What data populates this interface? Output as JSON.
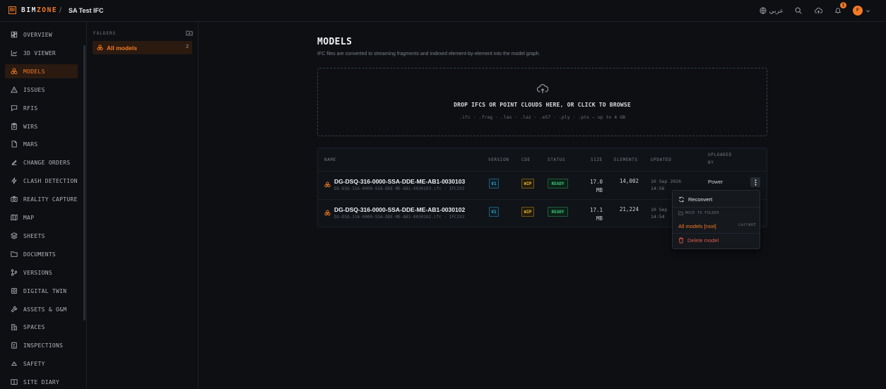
{
  "app": {
    "logo_mark": "BI",
    "logo_prefix": "BIM",
    "logo_suffix": "ZONE",
    "project": "SA Test IFC",
    "breadcrumb_separator": "/"
  },
  "topbar": {
    "language": "عربي",
    "notification_count": "1",
    "avatar_initial": "F"
  },
  "sidebar": {
    "items": [
      {
        "label": "OVERVIEW",
        "icon": "dashboard-icon"
      },
      {
        "label": "3D VIEWER",
        "icon": "chart-icon"
      },
      {
        "label": "MODELS",
        "icon": "models-icon",
        "active": true
      },
      {
        "label": "ISSUES",
        "icon": "warning-icon"
      },
      {
        "label": "RFIS",
        "icon": "chat-icon"
      },
      {
        "label": "WIRS",
        "icon": "clipboard-icon"
      },
      {
        "label": "MARS",
        "icon": "file-icon"
      },
      {
        "label": "CHANGE ORDERS",
        "icon": "edit-icon"
      },
      {
        "label": "CLASH DETECTION",
        "icon": "bolt-icon"
      },
      {
        "label": "REALITY CAPTURE",
        "icon": "camera-icon"
      },
      {
        "label": "MAP",
        "icon": "map-icon"
      },
      {
        "label": "SHEETS",
        "icon": "layers-icon"
      },
      {
        "label": "DOCUMENTS",
        "icon": "folder-icon"
      },
      {
        "label": "VERSIONS",
        "icon": "branch-icon"
      },
      {
        "label": "DIGITAL TWIN",
        "icon": "twin-icon"
      },
      {
        "label": "ASSETS & O&M",
        "icon": "wrench-icon"
      },
      {
        "label": "SPACES",
        "icon": "building-icon"
      },
      {
        "label": "INSPECTIONS",
        "icon": "checklist-icon"
      },
      {
        "label": "SAFETY",
        "icon": "hardhat-icon"
      },
      {
        "label": "SITE DIARY",
        "icon": "book-icon"
      }
    ]
  },
  "folders": {
    "title": "FOLDERS",
    "items": [
      {
        "label": "All models",
        "count": "2"
      }
    ]
  },
  "main": {
    "title": "MODELS",
    "subtitle": "IFC files are converted to streaming fragments and indexed element-by-element into the model graph.",
    "dropzone": {
      "title": "DROP IFCS OR POINT CLOUDS HERE, OR CLICK TO BROWSE",
      "formats": ".ifc · .frag · .las · .laz · .e57 · .ply · .pts — up to 4 GB"
    },
    "table": {
      "headers": {
        "name": "NAME",
        "version": "VERSION",
        "cde": "CDE",
        "status": "STATUS",
        "size": "SIZE",
        "elements": "ELEMENTS",
        "updated": "UPDATED",
        "uploaded_by_1": "UPLOADED",
        "uploaded_by_2": "BY"
      },
      "rows": [
        {
          "name": "DG-DSQ-316-0000-SSA-DDE-ME-AB1-0030103",
          "file": "DG-DSQ-316-0000-SSA-DDE-ME-AB1-0030103.ifc · IFC2X3",
          "version": "V1",
          "cde": "WIP",
          "status": "READY",
          "size_1": "17.0",
          "size_2": "MB",
          "elements": "14,002",
          "updated_1": "10 Sep 2026",
          "updated_2": "14:56",
          "by": "Power"
        },
        {
          "name": "DG-DSQ-316-0000-SSA-DDE-ME-AB1-0030102",
          "file": "DG-DSQ-316-0000-SSA-DDE-ME-AB1-0030102.ifc · IFC2X3",
          "version": "V1",
          "cde": "WIP",
          "status": "READY",
          "size_1": "17.1",
          "size_2": "MB",
          "elements": "21,224",
          "updated_1": "10 Sep",
          "updated_2": "14:54",
          "by": ""
        }
      ]
    }
  },
  "context_menu": {
    "reconvert": "Reconvert",
    "move_label": "MOVE TO FOLDER",
    "folder_option": "All models [root]",
    "folder_current": "current",
    "delete": "Delete model"
  },
  "colors": {
    "accent": "#f57a24",
    "danger": "#e05a4a",
    "ready": "#3bc47a",
    "wip": "#e8b530",
    "version": "#3aa7d8"
  }
}
